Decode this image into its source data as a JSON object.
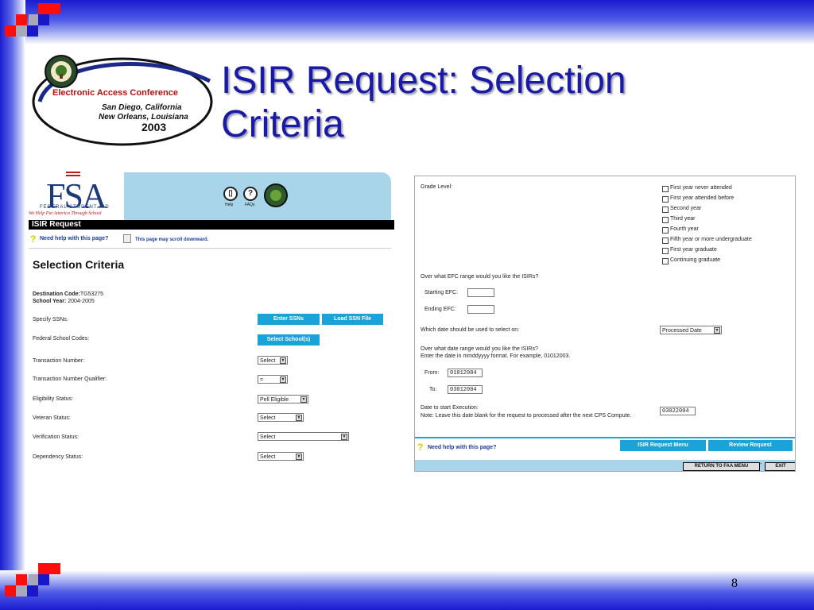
{
  "slide": {
    "title_line1": "ISIR Request: Selection",
    "title_line2": "Criteria",
    "page_number": "8"
  },
  "logo": {
    "line1": "Electronic Access Conference",
    "line2": "San Diego, California",
    "line3": "New Orleans, Louisiana",
    "line4": "2003"
  },
  "left_screen": {
    "brand": "FSA",
    "brand_sub": "FEDERAL STUDENT AID",
    "brand_tagline": "We Help Put America Through School",
    "help_icon_label": "Help",
    "faqs_icon_label": "FAQs",
    "bar_title": "ISIR Request",
    "need_help": "Need help with this page?",
    "scroll_note": "This page may scroll downward.",
    "section_title": "Selection Criteria",
    "dest_label": "Destination Code:",
    "dest_value": "TG53275",
    "year_label": "School Year:",
    "year_value": "2004-2005",
    "rows": {
      "specify_ssns": "Specify SSNs:",
      "school_codes": "Federal School Codes:",
      "txn_number": "Transaction Number:",
      "txn_qualifier": "Transaction Number Qualifier:",
      "eligibility": "Eligibility Status:",
      "veteran": "Veteran Status:",
      "verification": "Verification Status:",
      "dependency": "Dependency Status:"
    },
    "buttons": {
      "enter_ssns": "Enter SSNs",
      "load_ssn_file": "Load SSN File",
      "select_schools": "Select School(s)"
    },
    "selects": {
      "txn_number": "Select",
      "txn_qualifier": "=",
      "eligibility": "Pell Eligible",
      "veteran": "Select",
      "verification": "Select",
      "dependency": "Select"
    }
  },
  "right_screen": {
    "grade_level_label": "Grade Level:",
    "grade_options": [
      "First year never attended",
      "First year attended before",
      "Second year",
      "Third year",
      "Fourth year",
      "Fifth year or more undergraduate",
      "First year graduate",
      "Continuing graduate"
    ],
    "efc_question": "Over what EFC range would you like the ISIRs?",
    "starting_efc_label": "Starting EFC:",
    "ending_efc_label": "Ending EFC:",
    "date_select_question": "Which date should be used to select on:",
    "date_select_value": "Processed Date",
    "date_range_question": "Over what date range would you like the ISIRs?",
    "date_format_note": "Enter the date in mmddyyyy format. For example, 01012003.",
    "from_label": "From:",
    "from_value": "01012004",
    "to_label": "To:",
    "to_value": "03012004",
    "exec_label": "Date to start Execution:",
    "exec_note": "Note: Leave this date blank for the request to processed after the next CPS Compute.",
    "exec_value": "03022004",
    "need_help": "Need help with this page?",
    "isir_menu_button": "ISIR Request Menu",
    "review_button": "Review Request",
    "return_button": "RETURN TO FAA MENU",
    "exit_button": "EXIT"
  },
  "colors": {
    "title": "#1a1aa8",
    "frame_blue": "#1b1bd0",
    "button_blue": "#1aa3d8",
    "header_light_blue": "#a9d5ea"
  }
}
